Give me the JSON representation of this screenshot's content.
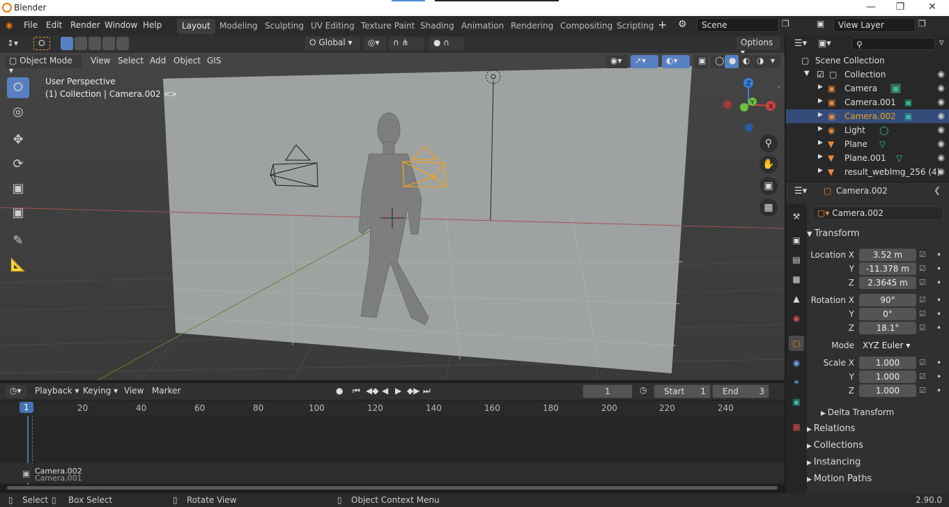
{
  "window": {
    "title": "Blender",
    "version": "2.90.0"
  },
  "menus": [
    "File",
    "Edit",
    "Render",
    "Window",
    "Help"
  ],
  "workspaces": [
    "Layout",
    "Modeling",
    "Sculpting",
    "UV Editing",
    "Texture Paint",
    "Shading",
    "Animation",
    "Rendering",
    "Compositing",
    "Scripting"
  ],
  "active_workspace": "Layout",
  "scene": {
    "name": "Scene",
    "view_layer": "View Layer"
  },
  "viewport_header": {
    "transform_orientation": "Global",
    "options_label": "Options",
    "mode": "Object Mode",
    "menu": [
      "View",
      "Select",
      "Add",
      "Object",
      "GIS"
    ]
  },
  "viewport": {
    "perspective_label": "User Perspective",
    "collection_label": "(1) Collection | Camera.002 <>",
    "colors": {
      "selected": "#f0a020",
      "x_axis": "#d04040",
      "y_axis": "#70c040",
      "z_axis": "#3a80e0"
    }
  },
  "timeline": {
    "menu": [
      "Playback",
      "Keying",
      "View",
      "Marker"
    ],
    "current_frame": "1",
    "start_label": "Start",
    "start": "1",
    "end_label": "End",
    "end": "3",
    "ruler": [
      "1",
      "20",
      "40",
      "60",
      "80",
      "100",
      "120",
      "140",
      "160",
      "180",
      "200",
      "220",
      "240"
    ],
    "tracks": [
      "Camera.002",
      "Camera.001"
    ]
  },
  "statusbar": {
    "select": "Select",
    "box_select": "Box Select",
    "rotate_view": "Rotate View",
    "context_menu": "Object Context Menu"
  },
  "outliner": {
    "root": "Scene Collection",
    "collection": "Collection",
    "items": [
      {
        "name": "Camera",
        "icon": "camera-icon"
      },
      {
        "name": "Camera.001",
        "icon": "camera-icon"
      },
      {
        "name": "Camera.002",
        "icon": "camera-icon",
        "selected": true
      },
      {
        "name": "Light",
        "icon": "light-icon"
      },
      {
        "name": "Plane",
        "icon": "mesh-icon"
      },
      {
        "name": "Plane.001",
        "icon": "mesh-icon"
      },
      {
        "name": "result_webImg_256 (4)",
        "icon": "mesh-icon"
      }
    ]
  },
  "properties": {
    "object_name": "Camera.002",
    "transform_label": "Transform",
    "location_label": "Location X",
    "y_label": "Y",
    "z_label": "Z",
    "location": {
      "x": "3.52 m",
      "y": "-11.378 m",
      "z": "2.3645 m"
    },
    "rotation_label": "Rotation X",
    "rotation": {
      "x": "90°",
      "y": "0°",
      "z": "18.1°"
    },
    "mode_label": "Mode",
    "mode": "XYZ Euler",
    "scale_label": "Scale X",
    "scale": {
      "x": "1.000",
      "y": "1.000",
      "z": "1.000"
    },
    "panels": [
      "Delta Transform",
      "Relations",
      "Collections",
      "Instancing",
      "Motion Paths"
    ]
  }
}
